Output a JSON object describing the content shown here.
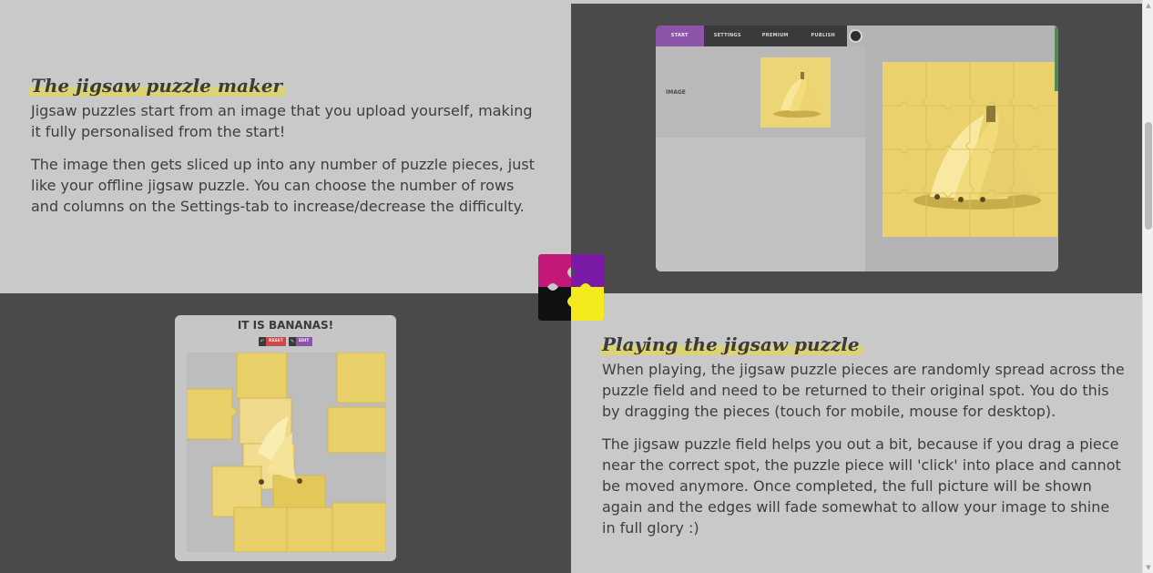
{
  "section1": {
    "heading": "The jigsaw puzzle maker",
    "para1": "Jigsaw puzzles start from an image that you upload yourself, making it fully personalised from the start!",
    "para2": "The image then gets sliced up into any number of puzzle pieces, just like your offline jigsaw puzzle. You can choose the number of rows and columns on the Settings-tab to increase/decrease the difficulty."
  },
  "section2": {
    "heading": "Playing the jigsaw puzzle",
    "para1": "When playing, the jigsaw puzzle pieces are randomly spread across the puzzle field and need to be returned to their original spot. You do this by dragging the pieces (touch for mobile, mouse for desktop).",
    "para2": "The jigsaw puzzle field helps you out a bit, because if you drag a piece near the correct spot, the puzzle piece will 'click' into place and cannot be moved anymore. Once completed, the full picture will be shown again and the edges will fade somewhat to allow your image to shine in full glory :)"
  },
  "editor": {
    "tabs": [
      "START",
      "SETTINGS",
      "PREMIUM",
      "PUBLISH"
    ],
    "active_tab": "START",
    "image_label": "IMAGE"
  },
  "player": {
    "title": "IT IS BANANAS!",
    "reset_label": "RESET",
    "edit_label": "EDIT"
  },
  "icons": {
    "globe": "globe-icon",
    "reset": "undo-icon",
    "edit": "edit-icon",
    "logo": "puzzle-logo-icon"
  },
  "colors": {
    "dark_band": "#4a4a4a",
    "light_band": "#c9c9c9",
    "highlight": "#e2d65a",
    "logo_magenta": "#c2187a",
    "logo_purple": "#7a1aa6",
    "logo_black": "#111111",
    "logo_yellow": "#f4ea1c",
    "banana_yellow": "#e6cd62"
  }
}
